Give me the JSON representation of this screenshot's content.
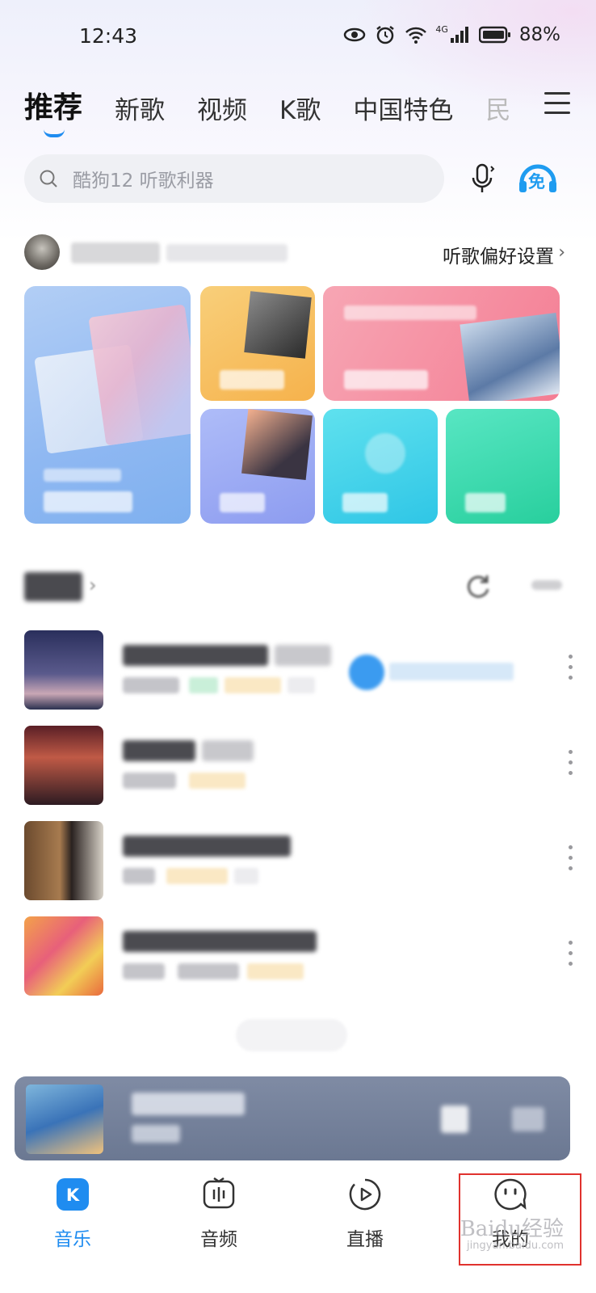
{
  "status_bar": {
    "time": "12:43",
    "network": "4G",
    "battery": "88%"
  },
  "tabs": [
    {
      "label": "推荐",
      "active": true
    },
    {
      "label": "新歌"
    },
    {
      "label": "视频"
    },
    {
      "label": "K歌"
    },
    {
      "label": "中国特色"
    },
    {
      "label": "民"
    }
  ],
  "search": {
    "placeholder": "酷狗12 听歌利器"
  },
  "free_badge": "免",
  "profile": {
    "preference_label": "听歌偏好设置",
    "chevron": "›"
  },
  "new_songs": {
    "chevron": "›"
  },
  "bottom_nav": [
    {
      "label": "音乐",
      "icon": "K",
      "active": true
    },
    {
      "label": "音频"
    },
    {
      "label": "直播"
    },
    {
      "label": "我的"
    }
  ],
  "watermark": {
    "text": "Baidu经验",
    "sub": "jingyan.baidu.com"
  },
  "colors": {
    "accent": "#1f8cf0",
    "highlight_box": "#e0322e"
  }
}
